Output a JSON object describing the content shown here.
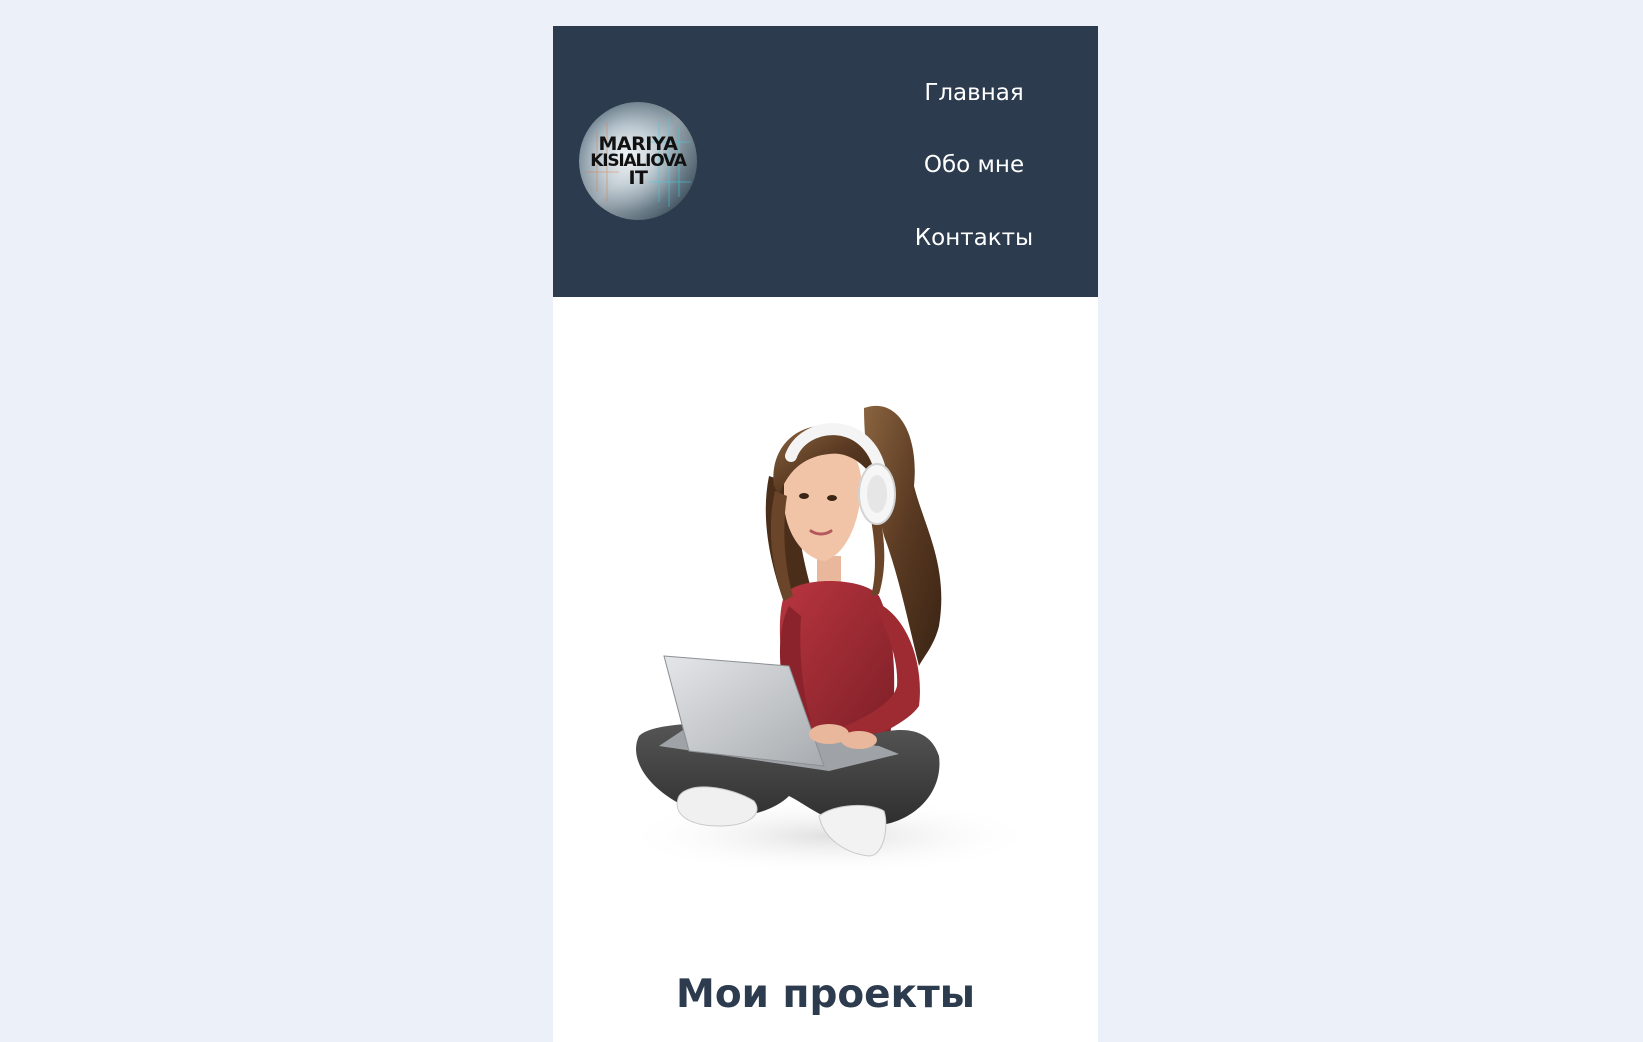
{
  "logo": {
    "line1": "MARIYA",
    "line2": "KISIALIOVA",
    "line3": "IT"
  },
  "nav": {
    "items": [
      {
        "label": "Главная"
      },
      {
        "label": "Обо мне"
      },
      {
        "label": "Контакты"
      }
    ]
  },
  "hero": {
    "image_icon": "girl-with-laptop-illustration"
  },
  "main": {
    "section_title": "Мои проекты"
  },
  "colors": {
    "background": "#ecf0f8",
    "header": "#2d3b4f",
    "title": "#2d3b4f",
    "sweater": "#9e2a32",
    "hair": "#5a3a22"
  }
}
